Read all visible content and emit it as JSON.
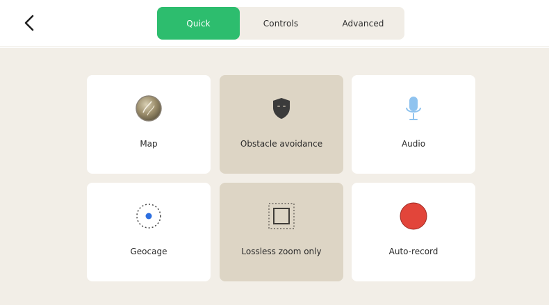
{
  "header": {
    "back_icon": "chevron-left-icon",
    "tabs": [
      {
        "label": "Quick",
        "active": true
      },
      {
        "label": "Controls",
        "active": false
      },
      {
        "label": "Advanced",
        "active": false
      }
    ]
  },
  "tiles": [
    {
      "label": "Map",
      "icon": "map-thumbnail-icon",
      "selected": false
    },
    {
      "label": "Obstacle avoidance",
      "icon": "shield-icon",
      "selected": true
    },
    {
      "label": "Audio",
      "icon": "microphone-icon",
      "selected": false
    },
    {
      "label": "Geocage",
      "icon": "geocage-icon",
      "selected": false
    },
    {
      "label": "Lossless zoom only",
      "icon": "zoom-frame-icon",
      "selected": true
    },
    {
      "label": "Auto-record",
      "icon": "record-icon",
      "selected": false
    }
  ],
  "colors": {
    "accent": "#2dbd6e",
    "background": "#f2eee7",
    "tile": "#ffffff",
    "tile_selected": "#ddd5c5",
    "record": "#e2453a",
    "geocage_dot": "#2d6fe0",
    "microphone": "#8fc3ef",
    "shield": "#3b3b3b"
  }
}
